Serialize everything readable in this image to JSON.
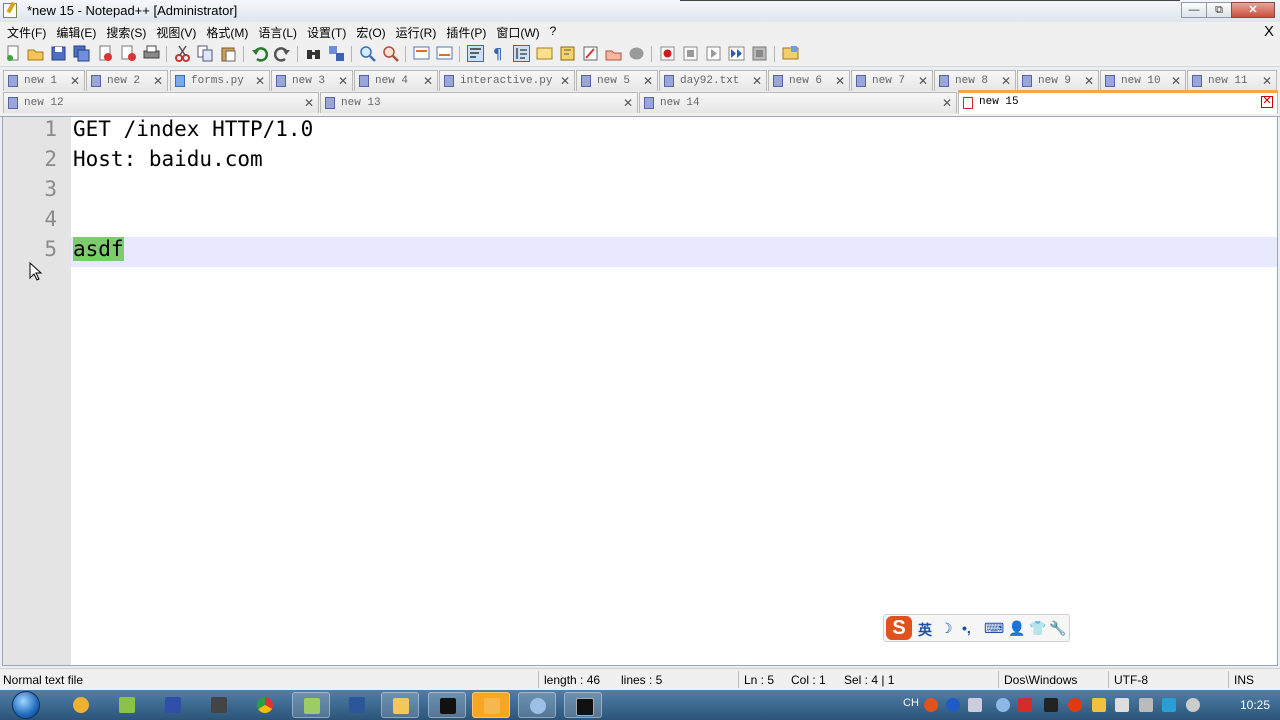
{
  "window": {
    "title": "*new 15 - Notepad++ [Administrator]",
    "controls": {
      "minimize": "—",
      "maximize": "⧉",
      "close": "✕"
    }
  },
  "menu": {
    "items": [
      "文件(F)",
      "编辑(E)",
      "搜索(S)",
      "视图(V)",
      "格式(M)",
      "语言(L)",
      "设置(T)",
      "宏(O)",
      "运行(R)",
      "插件(P)",
      "窗口(W)",
      "?"
    ],
    "close": "X"
  },
  "tabs_row1": [
    {
      "label": "new 1",
      "type": "txt"
    },
    {
      "label": "new 2",
      "type": "txt"
    },
    {
      "label": "forms.py",
      "type": "py"
    },
    {
      "label": "new 3",
      "type": "txt"
    },
    {
      "label": "new 4",
      "type": "txt"
    },
    {
      "label": "interactive.py",
      "type": "txt"
    },
    {
      "label": "new 5",
      "type": "txt"
    },
    {
      "label": "day92.txt",
      "type": "txt"
    },
    {
      "label": "new 6",
      "type": "txt"
    },
    {
      "label": "new 7",
      "type": "txt"
    },
    {
      "label": "new 8",
      "type": "txt"
    },
    {
      "label": "new 9",
      "type": "txt"
    },
    {
      "label": "new 10",
      "type": "txt"
    },
    {
      "label": "new 11",
      "type": "txt"
    }
  ],
  "tabs_row2": [
    {
      "label": "new 12",
      "type": "txt"
    },
    {
      "label": "new 13",
      "type": "txt"
    },
    {
      "label": "new 14",
      "type": "txt"
    },
    {
      "label": "new 15",
      "type": "red",
      "active": true
    }
  ],
  "tab_close": "✕",
  "editor": {
    "line_numbers": [
      "1",
      "2",
      "3",
      "4",
      "5"
    ],
    "lines": [
      "GET /index HTTP/1.0",
      "Host: baidu.com",
      "",
      "",
      "asdf"
    ],
    "current_line": 5,
    "selected_text": "asdf"
  },
  "ime": {
    "logo": "S",
    "mode": "英",
    "icons": [
      "☽",
      "•,",
      "⌨",
      "👤",
      "👕",
      "🔧"
    ]
  },
  "status": {
    "file_type": "Normal text file",
    "length": "length : 46",
    "lines": "lines : 5",
    "ln": "Ln : 5",
    "col": "Col : 1",
    "sel": "Sel : 4 | 1",
    "eol": "Dos\\Windows",
    "encoding": "UTF-8",
    "mode": "INS"
  },
  "taskbar": {
    "tray_lang": "CH",
    "clock": "10:25"
  },
  "colors": {
    "selection": "#7ecb6f",
    "current_line": "#e8e8ff",
    "active_tab_accent": "#f7a740"
  }
}
